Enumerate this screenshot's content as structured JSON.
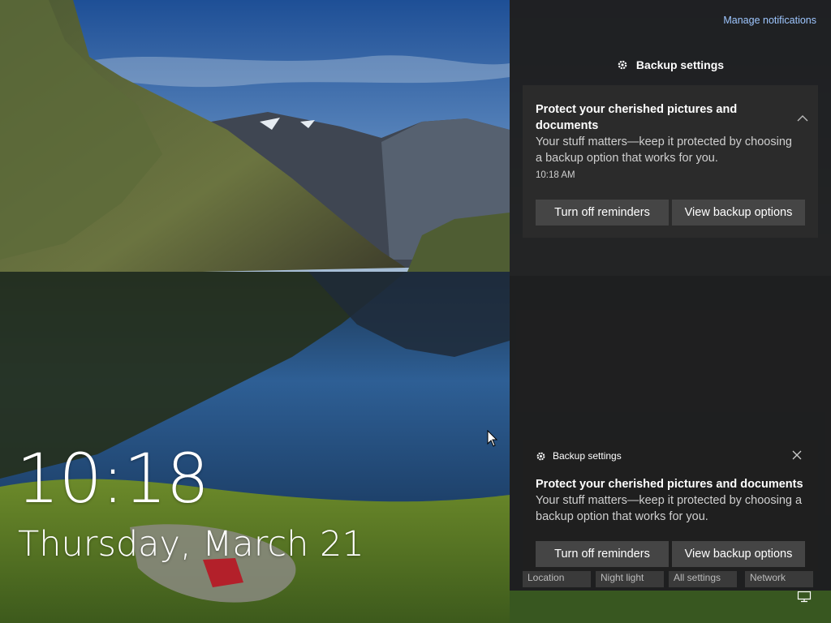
{
  "lock_screen": {
    "time": "10:18",
    "date": "Thursday, March 21"
  },
  "action_center": {
    "manage_notifications": "Manage notifications",
    "group_header": {
      "icon": "gear-icon",
      "label": "Backup settings"
    },
    "notification": {
      "title": "Protect your cherished pictures and documents",
      "body": "Your stuff matters—keep it protected by choosing a backup option that works for you.",
      "time": "10:18 AM",
      "collapse_icon": "chevron-up-icon",
      "buttons": {
        "turn_off": "Turn off reminders",
        "view": "View backup options"
      }
    },
    "quick_actions": [
      "Location",
      "Night light",
      "All settings",
      "Network"
    ]
  },
  "toast": {
    "app_icon": "gear-icon",
    "app_name": "Backup settings",
    "close_icon": "close-icon",
    "title": "Protect your cherished pictures and documents",
    "body": "Your stuff matters—keep it protected by choosing a backup option that works for you.",
    "buttons": {
      "turn_off": "Turn off reminders",
      "view": "View backup options"
    }
  },
  "taskbar": {
    "notification_icon": "action-center-icon"
  }
}
